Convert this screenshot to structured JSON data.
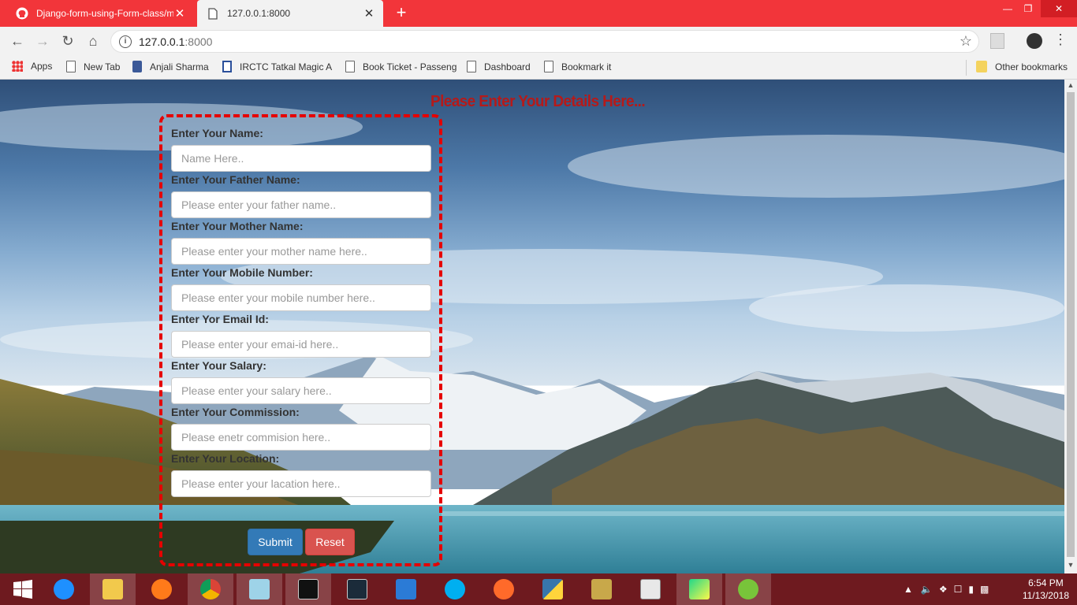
{
  "browser": {
    "tabs": [
      {
        "title": "Django-form-using-Form-class/m",
        "icon": "github-icon",
        "active": false
      },
      {
        "title": "127.0.0.1:8000",
        "icon": "page-icon",
        "active": true
      }
    ],
    "url_host": "127.0.0.1",
    "url_port": ":8000",
    "bookmarks": [
      {
        "label": "Apps",
        "icon": "apps-icon"
      },
      {
        "label": "New Tab",
        "icon": "page-icon"
      },
      {
        "label": "Anjali Sharma",
        "icon": "facebook-icon"
      },
      {
        "label": "IRCTC Tatkal Magic A",
        "icon": "irctc-icon"
      },
      {
        "label": "Book Ticket - Passeng",
        "icon": "page-icon"
      },
      {
        "label": "Dashboard",
        "icon": "page-icon"
      },
      {
        "label": "Bookmark it",
        "icon": "page-icon"
      }
    ],
    "other_bookmarks": "Other bookmarks"
  },
  "page": {
    "heading": "Please Enter Your Details Here...",
    "fields": [
      {
        "label": "Enter Your Name:",
        "placeholder": "Name Here.."
      },
      {
        "label": "Enter Your Father Name:",
        "placeholder": "Please enter your father name.."
      },
      {
        "label": "Enter Your Mother Name:",
        "placeholder": "Please enter your mother name here.."
      },
      {
        "label": "Enter Your Mobile Number:",
        "placeholder": "Please enter your mobile number here.."
      },
      {
        "label": "Enter Yor Email Id:",
        "placeholder": "Please enter your emai-id here.."
      },
      {
        "label": "Enter Your Salary:",
        "placeholder": "Please enter your salary here.."
      },
      {
        "label": "Enter Your Commission:",
        "placeholder": "Please enetr commision here.."
      },
      {
        "label": "Enter Your Location:",
        "placeholder": "Please enter your lacation here.."
      }
    ],
    "submit_label": "Submit",
    "reset_label": "Reset",
    "colors": {
      "heading": "#b51a1a",
      "border": "#e50000",
      "submit": "#337ab7",
      "reset": "#d9534f"
    }
  },
  "taskbar": {
    "apps": [
      "start-icon",
      "internet-explorer-icon",
      "file-explorer-icon",
      "firefox-icon",
      "chrome-icon",
      "notepad-icon",
      "cmd-icon",
      "mysql-icon",
      "vscode-icon",
      "skype-icon",
      "tool-icon",
      "python-icon",
      "settings-icon",
      "window-icon",
      "pycharm-icon",
      "utorrent-icon"
    ],
    "time": "6:54 PM",
    "date": "11/13/2018"
  }
}
